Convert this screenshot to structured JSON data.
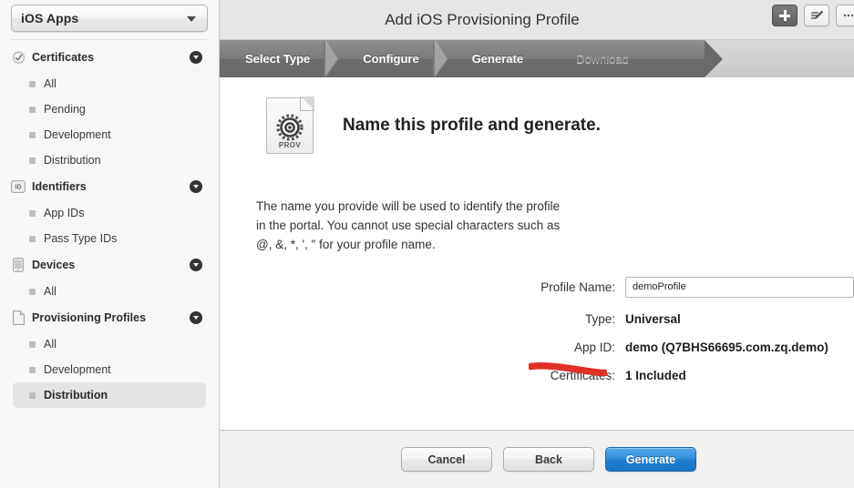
{
  "sidebar": {
    "team_selector": {
      "label": "iOS Apps",
      "icon": "chevron-down-icon"
    },
    "sections": [
      {
        "label": "Certificates",
        "icon": "certificate-seal-icon",
        "disclosure": "chevron-down-circle-icon",
        "items": [
          {
            "label": "All",
            "selected": false
          },
          {
            "label": "Pending",
            "selected": false
          },
          {
            "label": "Development",
            "selected": false
          },
          {
            "label": "Distribution",
            "selected": false
          }
        ]
      },
      {
        "label": "Identifiers",
        "icon": "id-badge-icon",
        "disclosure": "chevron-down-circle-icon",
        "items": [
          {
            "label": "App IDs",
            "selected": false
          },
          {
            "label": "Pass Type IDs",
            "selected": false
          }
        ]
      },
      {
        "label": "Devices",
        "icon": "phone-icon",
        "disclosure": "chevron-down-circle-icon",
        "items": [
          {
            "label": "All",
            "selected": false
          }
        ]
      },
      {
        "label": "Provisioning Profiles",
        "icon": "document-icon",
        "disclosure": "chevron-down-circle-icon",
        "items": [
          {
            "label": "All",
            "selected": false
          },
          {
            "label": "Development",
            "selected": false
          },
          {
            "label": "Distribution",
            "selected": true
          }
        ]
      }
    ]
  },
  "topbar": {
    "title": "Add iOS Provisioning Profile",
    "actions": [
      {
        "name": "add-button",
        "icon": "plus-icon",
        "style": "dark"
      },
      {
        "name": "edit-button",
        "icon": "edit-pencil-icon",
        "style": "light"
      },
      {
        "name": "more-button",
        "icon": "more-icon",
        "style": "light"
      }
    ]
  },
  "steps": [
    {
      "label": "Select Type",
      "state": "done"
    },
    {
      "label": "Configure",
      "state": "done"
    },
    {
      "label": "Generate",
      "state": "active"
    },
    {
      "label": "Download",
      "state": "inactive"
    }
  ],
  "content": {
    "icon": {
      "name": "provisioning-profile-icon",
      "caption": "PROV"
    },
    "heading": "Name this profile and generate.",
    "description": "The name you provide will be used to identify the profile in the portal. You cannot use special characters such as @, &, *, ', \" for your profile name.",
    "fields": [
      {
        "label": "Profile Name:",
        "type": "input",
        "value": "demoProfile",
        "placeholder": ""
      },
      {
        "label": "Type:",
        "type": "text",
        "value": "Universal"
      },
      {
        "label": "App ID:",
        "type": "text",
        "value": "demo (Q7BHS66695.com.zq.demo)"
      },
      {
        "label": "Certificates:",
        "type": "text",
        "value": "1 Included"
      }
    ]
  },
  "footer": {
    "buttons": [
      {
        "label": "Cancel",
        "style": "default"
      },
      {
        "label": "Back",
        "style": "default"
      },
      {
        "label": "Generate",
        "style": "primary"
      }
    ]
  },
  "annotation": {
    "type": "red-underline-stroke",
    "color": "#e03127"
  },
  "colors": {
    "accent": "#2f8ddc",
    "sidebar_bg": "#f7f7f7",
    "step_active": "#6a6a6a"
  }
}
